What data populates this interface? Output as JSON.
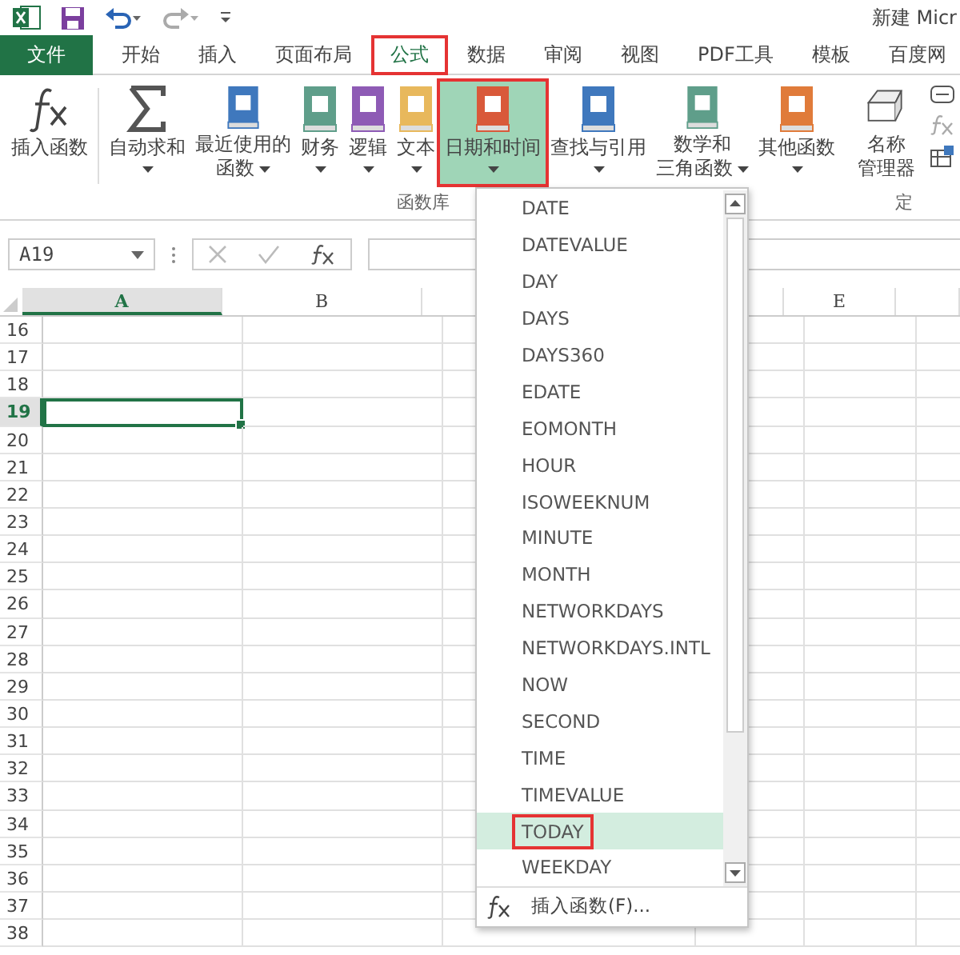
{
  "window": {
    "title": "新建 Micr"
  },
  "tabs": [
    {
      "label": "文件",
      "kind": "file",
      "selected": false,
      "highlighted": false
    },
    {
      "label": "开始",
      "kind": "tab",
      "selected": false,
      "highlighted": false
    },
    {
      "label": "插入",
      "kind": "tab",
      "selected": false,
      "highlighted": false
    },
    {
      "label": "页面布局",
      "kind": "tab",
      "selected": false,
      "highlighted": false
    },
    {
      "label": "公式",
      "kind": "tab",
      "selected": true,
      "highlighted": true
    },
    {
      "label": "数据",
      "kind": "tab",
      "selected": false,
      "highlighted": false
    },
    {
      "label": "审阅",
      "kind": "tab",
      "selected": false,
      "highlighted": false
    },
    {
      "label": "视图",
      "kind": "tab",
      "selected": false,
      "highlighted": false
    },
    {
      "label": "PDF工具",
      "kind": "tab",
      "selected": false,
      "highlighted": false
    },
    {
      "label": "模板",
      "kind": "tab",
      "selected": false,
      "highlighted": false
    },
    {
      "label": "百度网",
      "kind": "tab",
      "selected": false,
      "highlighted": false
    }
  ],
  "ribbon": {
    "groups": [
      {
        "label": "函数库",
        "buttons": [
          {
            "lines": [
              "插入函数"
            ],
            "kind": "fx",
            "caret": false,
            "pressed": false,
            "highlighted": false
          },
          {
            "lines": [
              "自动求和"
            ],
            "kind": "sigma",
            "caret": true,
            "pressed": false,
            "highlighted": false
          },
          {
            "lines": [
              "最近使用的",
              "函数"
            ],
            "kind": "book",
            "color": "#3f78bd",
            "caret": true,
            "pressed": false,
            "highlighted": false
          },
          {
            "lines": [
              "财务"
            ],
            "kind": "book",
            "color": "#5f9e8a",
            "caret": true,
            "pressed": false,
            "highlighted": false
          },
          {
            "lines": [
              "逻辑"
            ],
            "kind": "book",
            "color": "#8e5bb5",
            "caret": true,
            "pressed": false,
            "highlighted": false
          },
          {
            "lines": [
              "文本"
            ],
            "kind": "book",
            "color": "#e8b85c",
            "caret": true,
            "pressed": false,
            "highlighted": false
          },
          {
            "lines": [
              "日期和时间"
            ],
            "kind": "book",
            "color": "#d9593a",
            "caret": true,
            "pressed": true,
            "highlighted": true
          },
          {
            "lines": [
              "查找与引用"
            ],
            "kind": "book",
            "color": "#3f78bd",
            "caret": true,
            "pressed": false,
            "highlighted": false
          },
          {
            "lines": [
              "数学和",
              "三角函数"
            ],
            "kind": "book",
            "color": "#5f9e8a",
            "caret": true,
            "pressed": false,
            "highlighted": false
          },
          {
            "lines": [
              "其他函数"
            ],
            "kind": "book",
            "color": "#e07b3a",
            "caret": true,
            "pressed": false,
            "highlighted": false
          }
        ]
      },
      {
        "label": "定",
        "buttons": [
          {
            "lines": [
              "名称",
              "管理器"
            ],
            "kind": "names",
            "caret": false,
            "pressed": false,
            "highlighted": false
          }
        ]
      }
    ]
  },
  "formula_bar": {
    "name_box": "A19"
  },
  "sheet": {
    "columns": [
      {
        "label": "A",
        "selected": true
      },
      {
        "label": "B",
        "selected": false
      },
      {
        "selected": false
      },
      {
        "selected": false
      },
      {
        "label": "E",
        "selected": false
      },
      {
        "selected": false
      }
    ],
    "rows": [
      {
        "label": "16",
        "selected": false
      },
      {
        "label": "17",
        "selected": false
      },
      {
        "label": "18",
        "selected": false
      },
      {
        "label": "19",
        "selected": true
      },
      {
        "label": "20",
        "selected": false
      },
      {
        "label": "21",
        "selected": false
      },
      {
        "label": "22",
        "selected": false
      },
      {
        "label": "23",
        "selected": false
      },
      {
        "label": "24",
        "selected": false
      },
      {
        "label": "25",
        "selected": false
      },
      {
        "label": "26",
        "selected": false
      },
      {
        "label": "27",
        "selected": false
      },
      {
        "label": "28",
        "selected": false
      },
      {
        "label": "29",
        "selected": false
      },
      {
        "label": "30",
        "selected": false
      },
      {
        "label": "31",
        "selected": false
      },
      {
        "label": "32",
        "selected": false
      },
      {
        "label": "33",
        "selected": false
      },
      {
        "label": "34",
        "selected": false
      },
      {
        "label": "35",
        "selected": false
      },
      {
        "label": "36",
        "selected": false
      },
      {
        "label": "37",
        "selected": false
      },
      {
        "label": "38",
        "selected": false
      }
    ]
  },
  "dropdown": {
    "items": [
      {
        "label": "DATE",
        "selected": false,
        "highlighted": false
      },
      {
        "label": "DATEVALUE",
        "selected": false,
        "highlighted": false
      },
      {
        "label": "DAY",
        "selected": false,
        "highlighted": false
      },
      {
        "label": "DAYS",
        "selected": false,
        "highlighted": false
      },
      {
        "label": "DAYS360",
        "selected": false,
        "highlighted": false
      },
      {
        "label": "EDATE",
        "selected": false,
        "highlighted": false
      },
      {
        "label": "EOMONTH",
        "selected": false,
        "highlighted": false
      },
      {
        "label": "HOUR",
        "selected": false,
        "highlighted": false
      },
      {
        "label": "ISOWEEKNUM",
        "selected": false,
        "highlighted": false
      },
      {
        "label": "MINUTE",
        "selected": false,
        "highlighted": false
      },
      {
        "label": "MONTH",
        "selected": false,
        "highlighted": false
      },
      {
        "label": "NETWORKDAYS",
        "selected": false,
        "highlighted": false
      },
      {
        "label": "NETWORKDAYS.INTL",
        "selected": false,
        "highlighted": false
      },
      {
        "label": "NOW",
        "selected": false,
        "highlighted": false
      },
      {
        "label": "SECOND",
        "selected": false,
        "highlighted": false
      },
      {
        "label": "TIME",
        "selected": false,
        "highlighted": false
      },
      {
        "label": "TIMEVALUE",
        "selected": false,
        "highlighted": false
      },
      {
        "label": "TODAY",
        "selected": true,
        "highlighted": true
      },
      {
        "label": "WEEKDAY",
        "selected": false,
        "highlighted": false
      }
    ],
    "footer": "插入函数(F)..."
  }
}
